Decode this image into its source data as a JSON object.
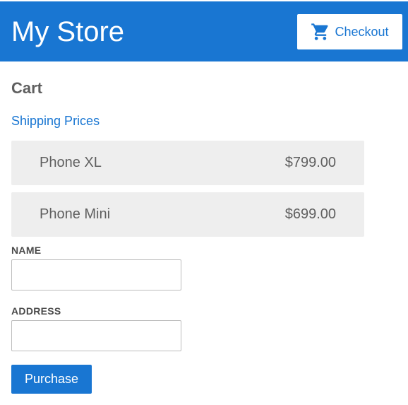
{
  "header": {
    "title": "My Store",
    "checkout_label": "Checkout",
    "checkout_icon": "shopping-cart-icon"
  },
  "cart": {
    "heading": "Cart",
    "shipping_link": "Shipping Prices",
    "items": [
      {
        "name": "Phone XL",
        "price": "$799.00"
      },
      {
        "name": "Phone Mini",
        "price": "$699.00"
      }
    ]
  },
  "form": {
    "name_label": "NAME",
    "name_value": "",
    "address_label": "ADDRESS",
    "address_value": "",
    "submit_label": "Purchase"
  },
  "colors": {
    "primary": "#1976d2",
    "item_background": "#eeeeee",
    "text": "#5f5f5f"
  }
}
